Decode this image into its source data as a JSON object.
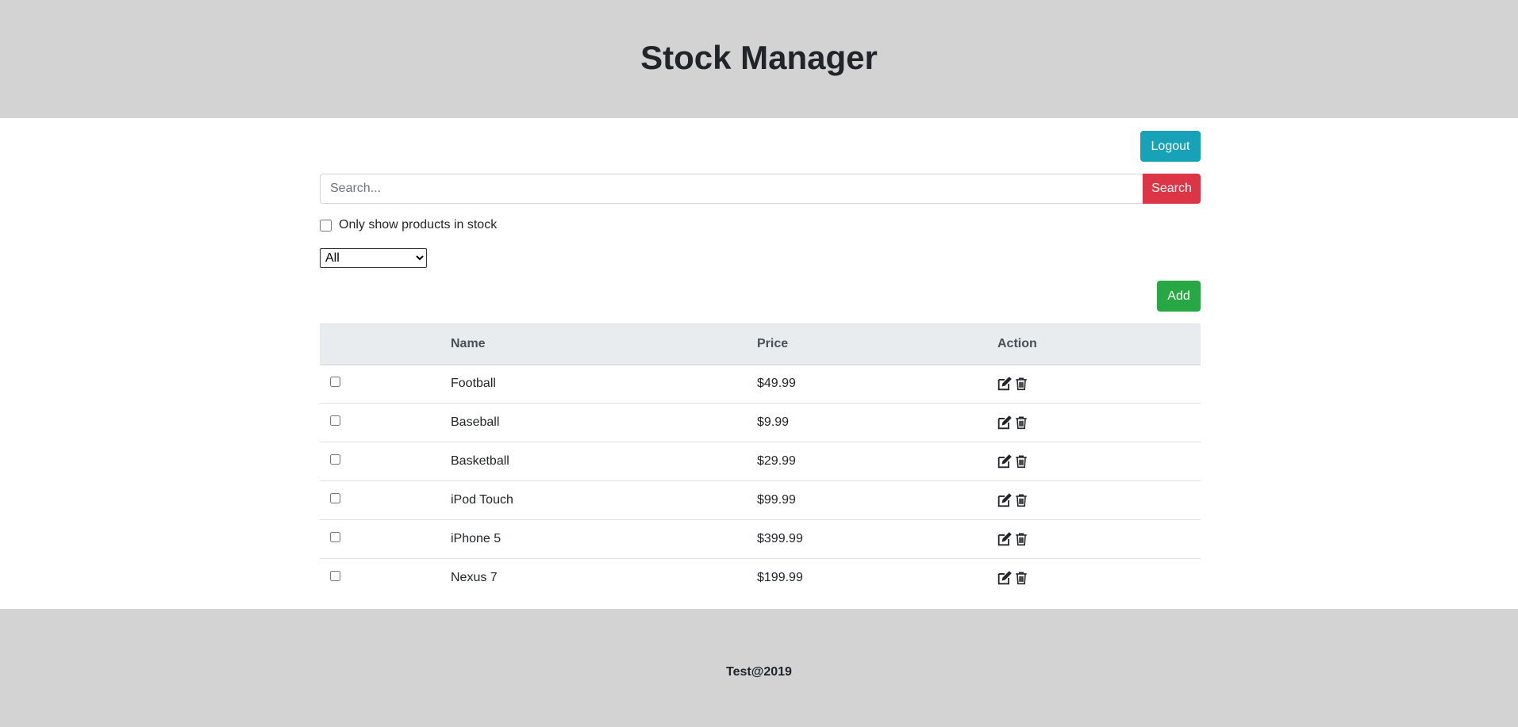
{
  "header": {
    "title": "Stock Manager"
  },
  "toolbar": {
    "logout_label": "Logout",
    "add_label": "Add"
  },
  "search": {
    "placeholder": "Search...",
    "value": "",
    "button_label": "Search"
  },
  "filter": {
    "in_stock_label": "Only show products in stock",
    "in_stock_checked": false
  },
  "category": {
    "selected": "All"
  },
  "table": {
    "columns": [
      "",
      "Name",
      "Price",
      "Action"
    ],
    "rows": [
      {
        "name": "Football",
        "price": "$49.99"
      },
      {
        "name": "Baseball",
        "price": "$9.99"
      },
      {
        "name": "Basketball",
        "price": "$29.99"
      },
      {
        "name": "iPod Touch",
        "price": "$99.99"
      },
      {
        "name": "iPhone 5",
        "price": "$399.99"
      },
      {
        "name": "Nexus 7",
        "price": "$199.99"
      }
    ],
    "action_icons": [
      "edit-icon",
      "trash-icon"
    ]
  },
  "footer": {
    "text": "Test@2019"
  },
  "colors": {
    "header_bg": "#d3d3d3",
    "logout": "#17a2b8",
    "search": "#dc3545",
    "add": "#28a745",
    "table_head": "#e9ecef"
  }
}
